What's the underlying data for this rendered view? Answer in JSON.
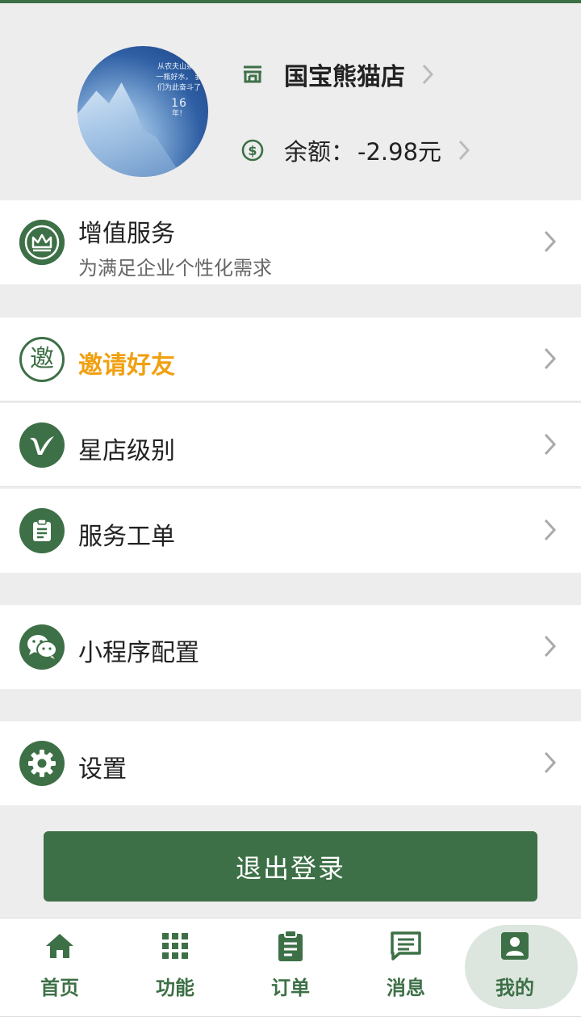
{
  "colors": {
    "accent": "#3d7046",
    "highlight": "#f0a010",
    "background": "#ededed"
  },
  "header": {
    "avatar_text": {
      "line1": "从农夫山泉到一瓶好水，",
      "line2": "我们为此奋斗了",
      "number": "16",
      "line3": "年！"
    },
    "store_name": "国宝熊猫店",
    "balance_label": "余额：",
    "balance_amount": "-2.98元"
  },
  "menu": {
    "value_added": {
      "title": "增值服务",
      "subtitle": "为满足企业个性化需求",
      "icon": "crown-icon"
    },
    "invite": {
      "title": "邀请好友",
      "icon_text": "邀",
      "icon": "invite-icon"
    },
    "star_level": {
      "title": "星店级别",
      "icon": "v-badge-icon"
    },
    "service_ticket": {
      "title": "服务工单",
      "icon": "clipboard-icon"
    },
    "mini_program": {
      "title": "小程序配置",
      "icon": "wechat-icon"
    },
    "settings": {
      "title": "设置",
      "icon": "gear-icon"
    }
  },
  "logout_label": "退出登录",
  "nav": {
    "home": "首页",
    "features": "功能",
    "orders": "订单",
    "messages": "消息",
    "mine": "我的"
  }
}
